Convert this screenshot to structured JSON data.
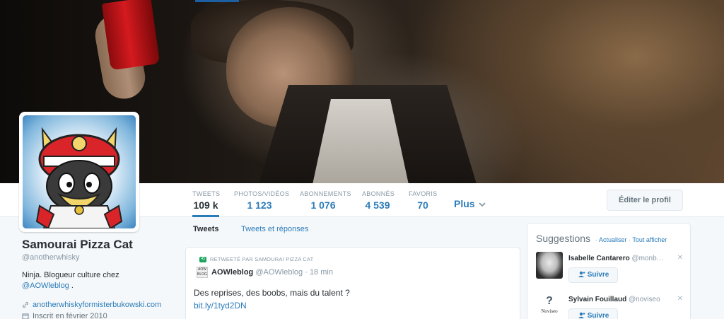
{
  "profile": {
    "name": "Samourai Pizza Cat",
    "handle": "@anotherwhisky",
    "bio_text": "Ninja. Blogueur culture chez",
    "bio_link": "@AOWleblog",
    "bio_suffix": " .",
    "website": "anotherwhiskyformisterbukowski.com",
    "joined": "Inscrit en février 2010"
  },
  "stats": [
    {
      "label": "TWEETS",
      "value": "109 k"
    },
    {
      "label": "PHOTOS/VIDÉOS",
      "value": "1 123"
    },
    {
      "label": "ABONNEMENTS",
      "value": "1 076"
    },
    {
      "label": "ABONNÉS",
      "value": "4 539"
    },
    {
      "label": "FAVORIS",
      "value": "70"
    }
  ],
  "nav": {
    "more": "Plus",
    "edit_profile": "Éditer le profil"
  },
  "tabs": [
    {
      "label": "Tweets"
    },
    {
      "label": "Tweets et réponses"
    }
  ],
  "tweet": {
    "retweet_note": "RETWEETÉ PAR SAMOURAI PIZZA CAT",
    "author_name": "AOWleblog",
    "author_handle": "@AOWleblog",
    "time": "· 18 min",
    "avatar_text": "AOW BLOG",
    "text": "Des reprises, des boobs, mais du talent ?",
    "link": "bit.ly/1tyd2DN"
  },
  "suggestions": {
    "title": "Suggestions",
    "refresh": "Actualiser",
    "view_all": "Tout afficher",
    "items": [
      {
        "name": "Isabelle Cantarero",
        "handle": "@monb…",
        "follow": "Suivre"
      },
      {
        "name": "Sylvain Fouillaud",
        "handle": "@noviseo",
        "follow": "Suivre",
        "avatar_text": "Noviseo"
      }
    ]
  },
  "colors": {
    "accent": "#2b7bb9",
    "retweet": "#19a35b",
    "text": "#292f33",
    "muted": "#8899a6"
  }
}
